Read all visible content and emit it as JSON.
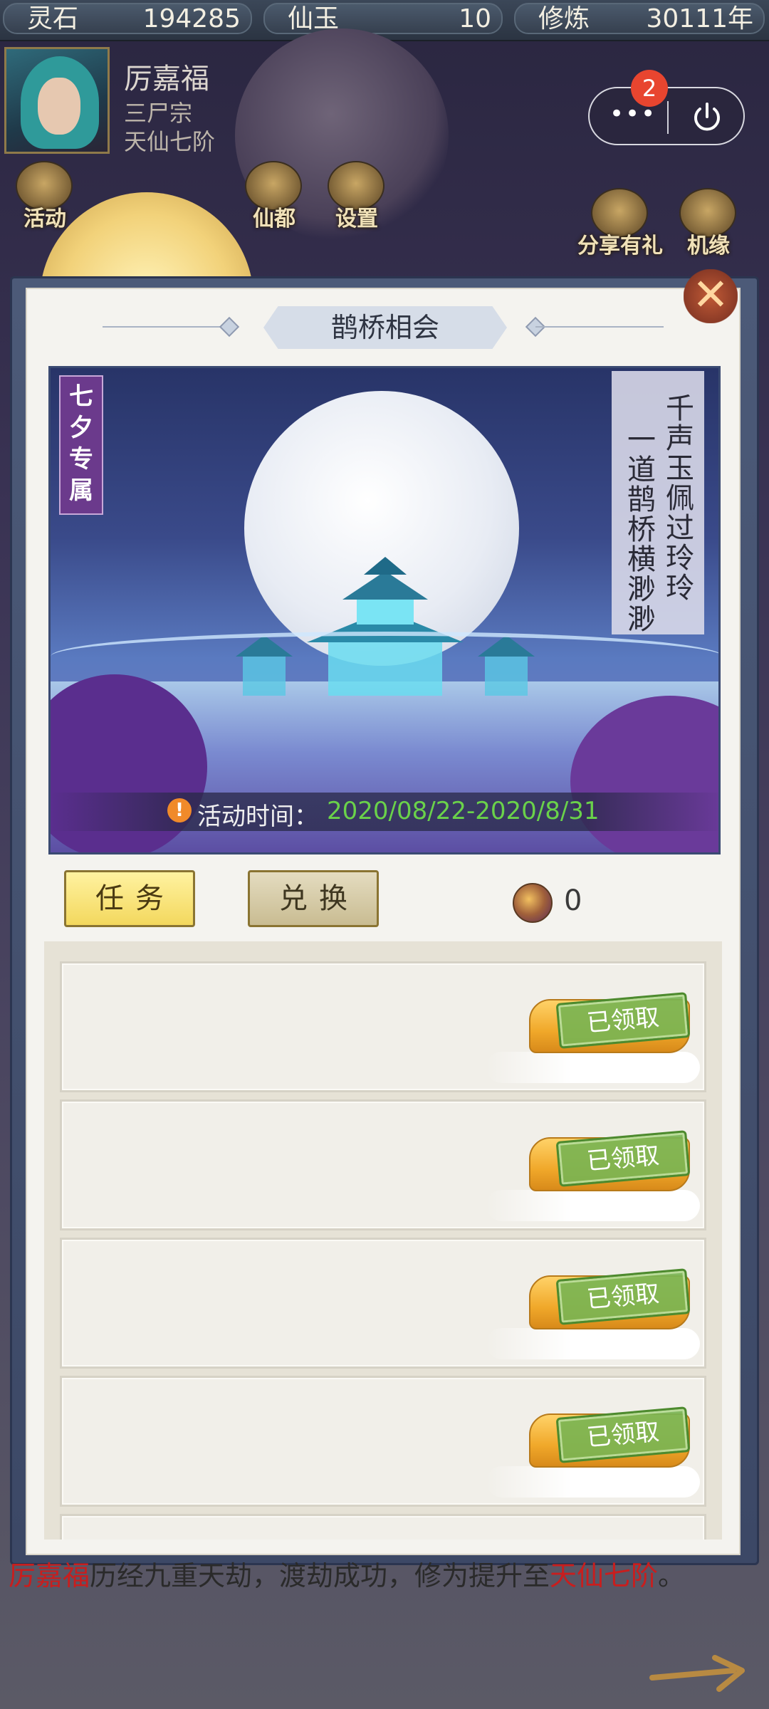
{
  "resources": [
    {
      "label": "灵石",
      "value": "194285"
    },
    {
      "label": "仙玉",
      "value": "10"
    },
    {
      "label": "修炼",
      "value": "30111年"
    }
  ],
  "player": {
    "name": "厉嘉福",
    "sect": "三尸宗",
    "rank": "天仙七阶"
  },
  "capsule": {
    "more_label": "•••",
    "badge_count": "2"
  },
  "header_icons": [
    {
      "label": "活动",
      "icon": "coin-icon"
    },
    {
      "label": "仙都",
      "icon": "pagoda-icon"
    },
    {
      "label": "设置",
      "icon": "gear-icon"
    },
    {
      "label": "分享有礼",
      "icon": "gift-icon"
    },
    {
      "label": "机缘",
      "icon": "cloud-icon"
    }
  ],
  "modal": {
    "title": "鹊桥相会",
    "close_label": "✕",
    "banner": {
      "tag": "七夕专属",
      "poem_line1": "千声玉佩过玲玲",
      "poem_line2": "一道鹊桥横渺渺",
      "time_label": "活动时间：",
      "time_value": "2020/08/22-2020/8/31",
      "warn_icon": "!"
    },
    "tabs": [
      {
        "label": "任务",
        "active": true
      },
      {
        "label": "兑换",
        "active": false
      }
    ],
    "currency": {
      "icon": "magpie-coin-icon",
      "value": "0"
    },
    "rows": [
      {
        "stamp": "已领取"
      },
      {
        "stamp": "已领取"
      },
      {
        "stamp": "已领取"
      },
      {
        "stamp": "已领取"
      }
    ]
  },
  "background_message": {
    "name": "厉嘉福",
    "middle": "历经九重天劫，渡劫成功，修为提升至",
    "rank": "天仙七阶",
    "end": "。"
  },
  "colors": {
    "accent_gold": "#f3d85e",
    "stamp_green": "#7ab452",
    "highlight_red": "#c81e1e",
    "time_green": "#6ad24a"
  }
}
